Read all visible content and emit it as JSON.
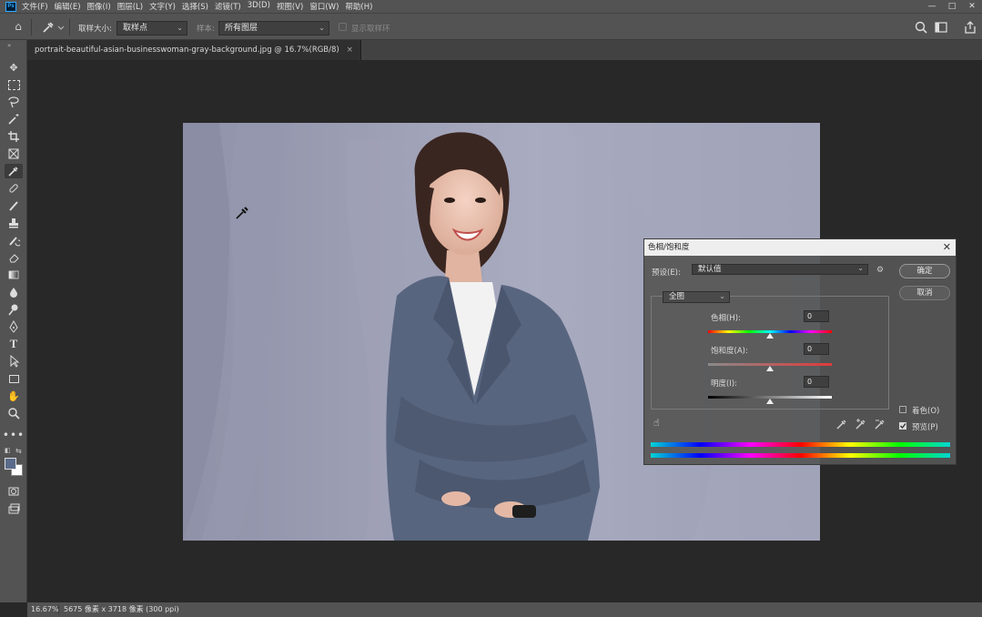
{
  "app": {
    "logo": "Ps"
  },
  "menu": [
    "文件(F)",
    "编辑(E)",
    "图像(I)",
    "图层(L)",
    "文字(Y)",
    "选择(S)",
    "滤镜(T)",
    "3D(D)",
    "视图(V)",
    "窗口(W)",
    "帮助(H)"
  ],
  "window_controls": {
    "minimize": "—",
    "maximize": "□",
    "close": "✕"
  },
  "options": {
    "sample_size_label": "取样大小:",
    "sample_size_value": "取样点",
    "sample_label": "样本:",
    "sample_value": "所有图层",
    "show_ring_label": "显示取样环"
  },
  "document": {
    "tab_title": "portrait-beautiful-asian-businesswoman-gray-background.jpg @ 16.7%(RGB/8)",
    "tab_close": "×"
  },
  "dialog": {
    "title": "色相/饱和度",
    "close": "✕",
    "preset_label": "预设(E):",
    "preset_value": "默认值",
    "ok": "确定",
    "cancel": "取消",
    "channel": "全图",
    "hue_label": "色相(H):",
    "hue_value": "0",
    "saturation_label": "饱和度(A):",
    "saturation_value": "0",
    "lightness_label": "明度(I):",
    "lightness_value": "0",
    "colorize_label": "着色(O)",
    "colorize_checked": false,
    "preview_label": "预览(P)",
    "preview_checked": true
  },
  "status": {
    "zoom": "16.67%",
    "doc_info": "5675 像素 x 3718 像素 (300 ppi)"
  },
  "colors": {
    "foreground": "#5a6a8a",
    "background": "#ffffff",
    "accent": "#31a8ff"
  }
}
